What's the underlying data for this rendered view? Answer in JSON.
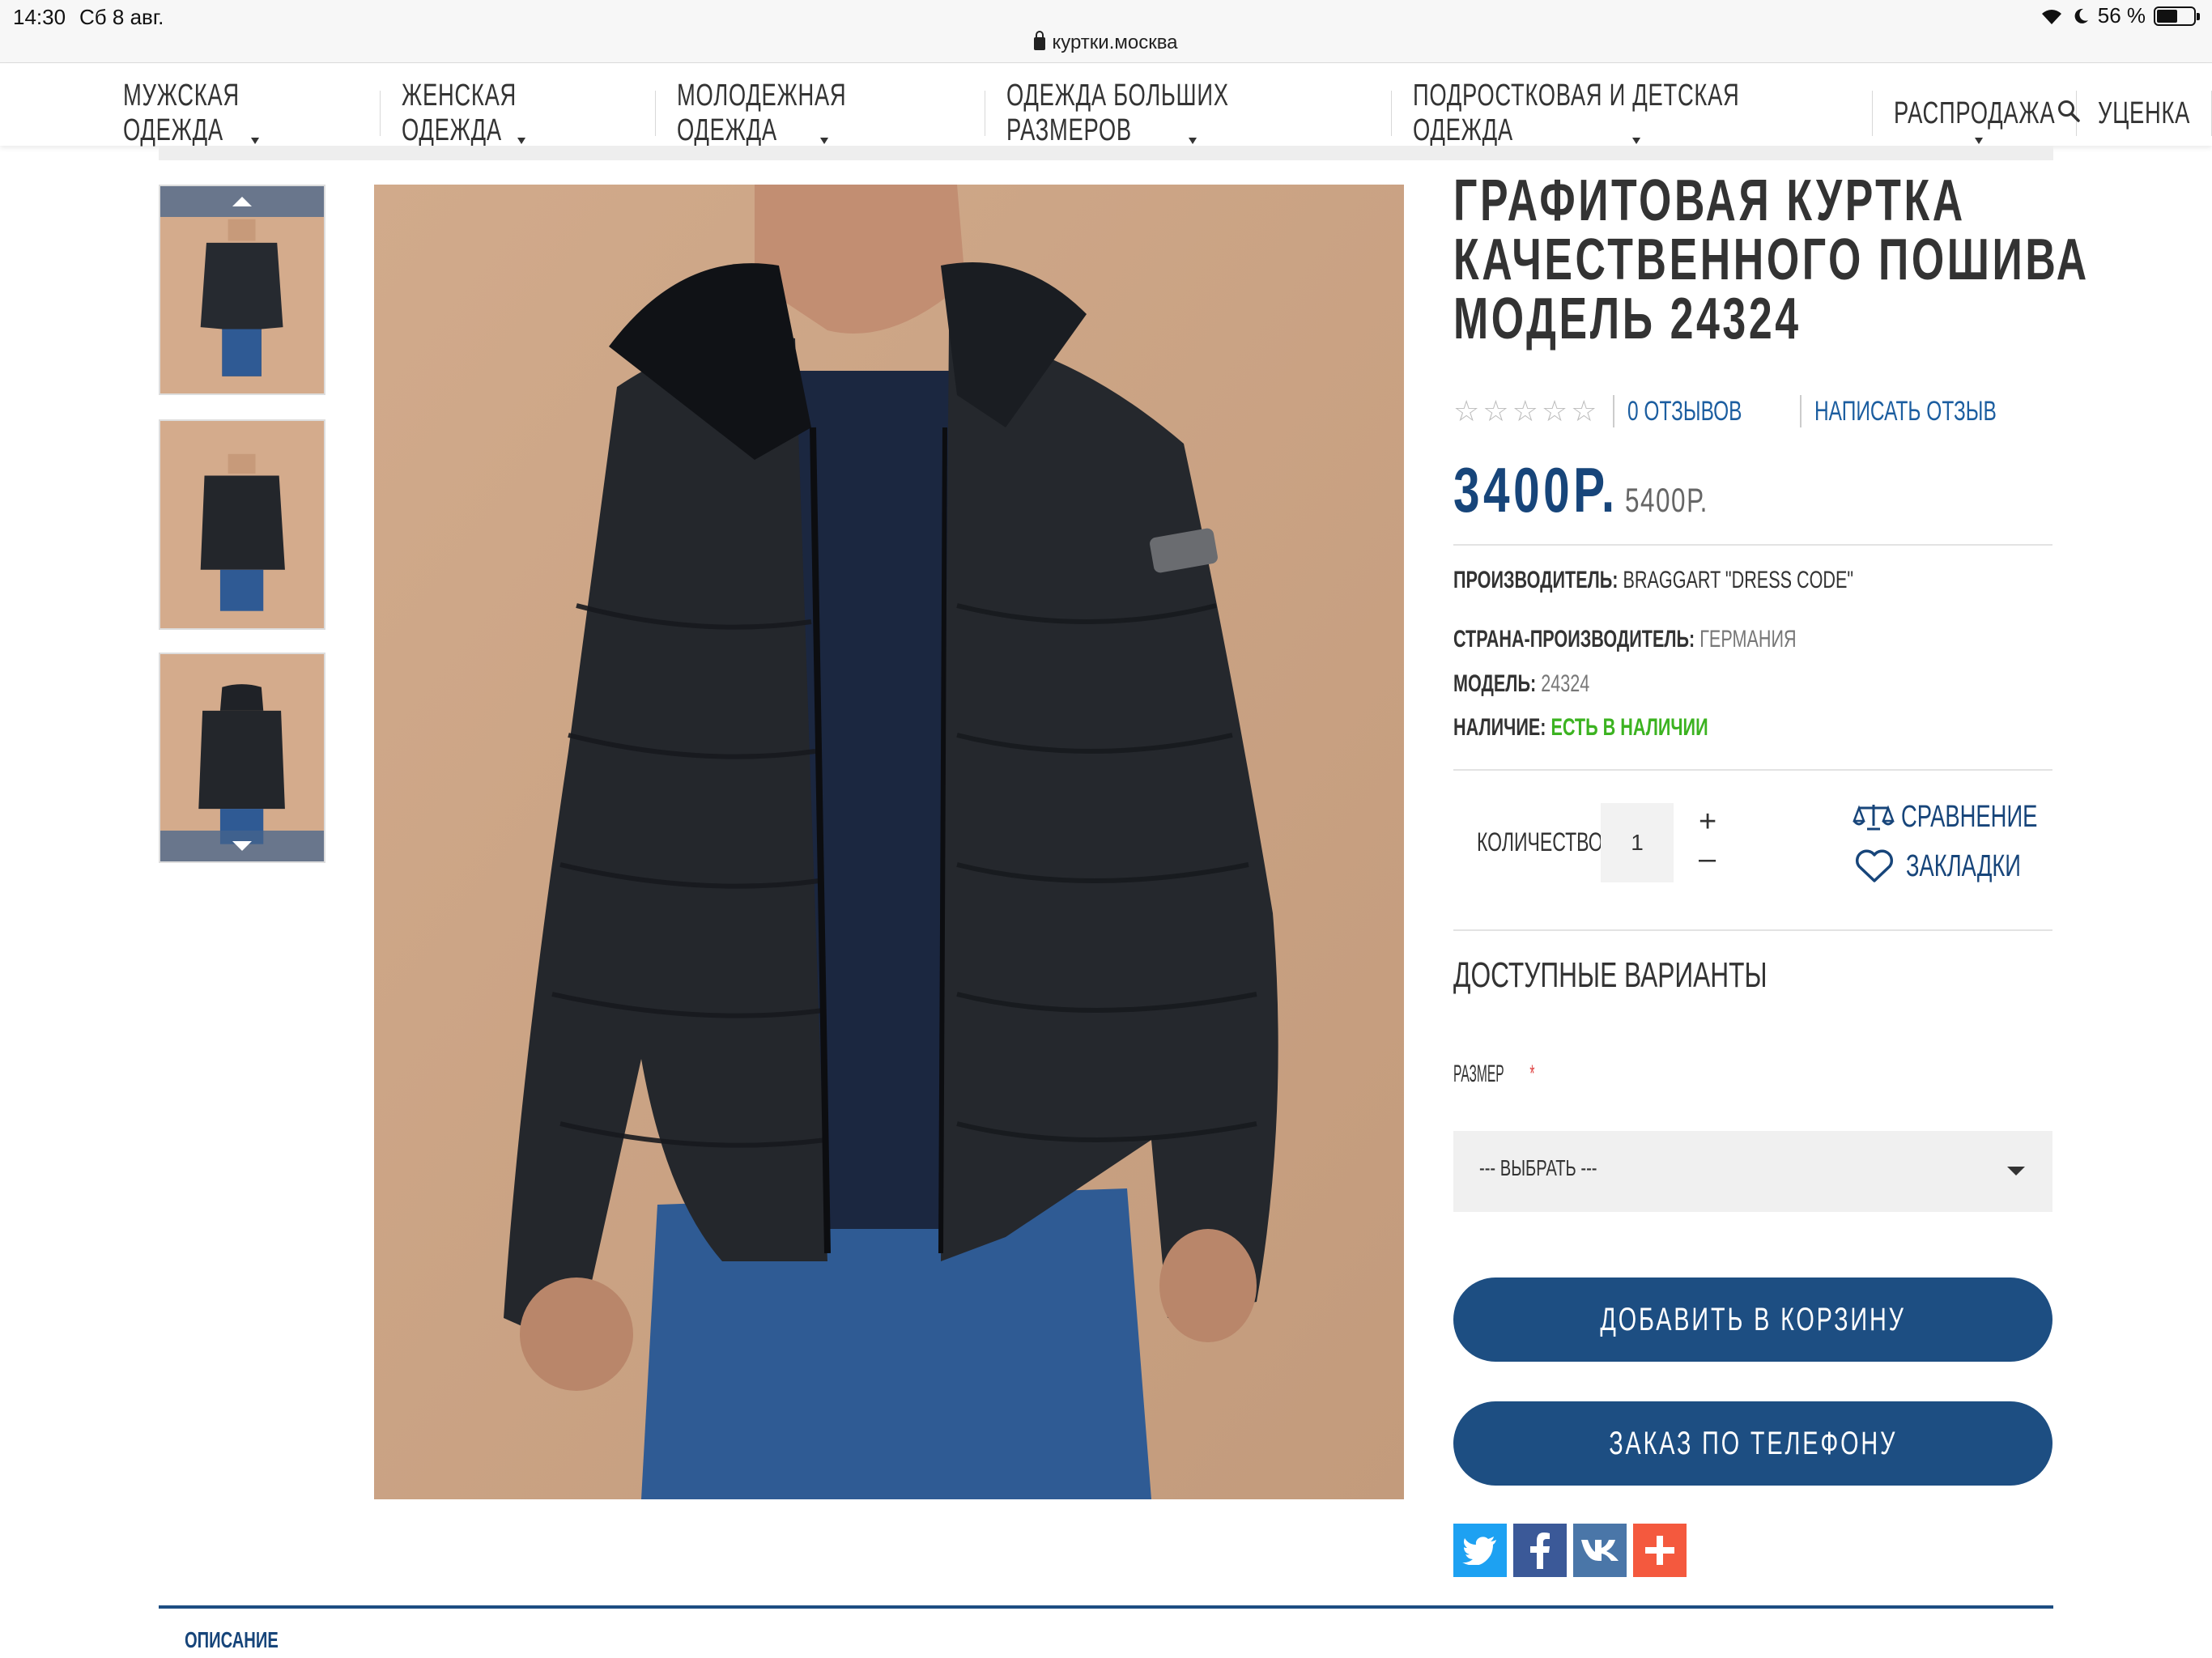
{
  "status_bar": {
    "time": "14:30",
    "date": "Сб 8 авг.",
    "battery": "56 %",
    "battery_level": 0.56
  },
  "url": "куртки.москва",
  "nav": {
    "items": [
      {
        "label": "МУЖСКАЯ ОДЕЖДА",
        "has_dropdown": true
      },
      {
        "label": "ЖЕНСКАЯ ОДЕЖДА",
        "has_dropdown": true
      },
      {
        "label": "МОЛОДЕЖНАЯ ОДЕЖДА",
        "has_dropdown": true
      },
      {
        "label": "ОДЕЖДА БОЛЬШИХ РАЗМЕРОВ",
        "has_dropdown": true
      },
      {
        "label": "ПОДРОСТКОВАЯ И ДЕТСКАЯ ОДЕЖДА",
        "has_dropdown": true
      },
      {
        "label": "РАСПРОДАЖА",
        "has_dropdown": true
      },
      {
        "label": "УЦЕНКА",
        "has_dropdown": false
      }
    ],
    "search_icon": "search-icon"
  },
  "product": {
    "title_lines": [
      "ГРАФИТОВАЯ КУРТКА",
      "КАЧЕСТВЕННОГО ПОШИВА",
      "МОДЕЛЬ 24324"
    ],
    "rating_stars": 0,
    "reviews_link": "0 ОТЗЫВОВ",
    "write_review_link": "НАПИСАТЬ ОТЗЫВ",
    "price": "3400Р.",
    "old_price": "5400Р.",
    "specs": {
      "manufacturer_label": "ПРОИЗВОДИТЕЛЬ:",
      "manufacturer_value": "BRAGGART \"DRESS CODE\"",
      "country_label": "СТРАНА-ПРОИЗВОДИТЕЛЬ:",
      "country_value": "ГЕРМАНИЯ",
      "model_label": "МОДЕЛЬ:",
      "model_value": "24324",
      "availability_label": "НАЛИЧИЕ:",
      "availability_value": "ЕСТЬ В НАЛИЧИИ"
    },
    "quantity_label": "КОЛИЧЕСТВО",
    "quantity_value": "1",
    "qty_plus": "+",
    "qty_minus": "–",
    "compare_label": "СРАВНЕНИЕ",
    "bookmarks_label": "ЗАКЛАДКИ",
    "variants_title": "ДОСТУПНЫЕ ВАРИАНТЫ",
    "size_label": "РАЗМЕР",
    "size_required_mark": "*",
    "size_select_value": "--- ВЫБРАТЬ ---",
    "add_to_cart": "ДОБАВИТЬ В КОРЗИНУ",
    "phone_order": "ЗАКАЗ ПО ТЕЛЕФОНУ"
  },
  "social": [
    {
      "name": "twitter-icon",
      "color": "#1da1f2"
    },
    {
      "name": "facebook-icon",
      "color": "#3b5998"
    },
    {
      "name": "vk-icon",
      "color": "#4a76a8"
    },
    {
      "name": "share-plus-icon",
      "color": "#f4593e"
    }
  ],
  "tabs": {
    "description": "ОПИСАНИЕ"
  },
  "colors": {
    "brand_blue": "#1d4e82",
    "link_blue": "#1c5ea0",
    "in_stock_green": "#3cb321",
    "image_background": "#caa283"
  }
}
